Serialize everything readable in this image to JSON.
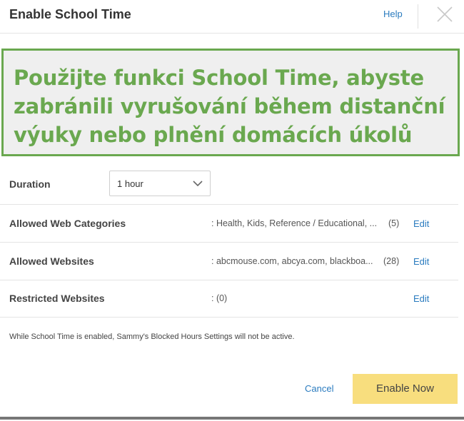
{
  "dialog": {
    "title": "Enable School Time",
    "help_label": "Help"
  },
  "banner": {
    "text": "Použijte funkci School Time, abyste zabránili vyrušování během distanční výuky nebo plnění domácích úkolů"
  },
  "duration": {
    "label": "Duration",
    "selected": "1 hour"
  },
  "rows": [
    {
      "label": "Allowed Web Categories",
      "value": ": Health, Kids, Reference / Educational, ...",
      "count": "(5)",
      "edit": "Edit"
    },
    {
      "label": "Allowed Websites",
      "value": ": abcmouse.com, abcya.com, blackboa...",
      "count": "(28)",
      "edit": "Edit"
    },
    {
      "label": "Restricted Websites",
      "value": ": (0)",
      "count": "",
      "edit": "Edit"
    }
  ],
  "note": "While School Time is enabled, Sammy's Blocked Hours Settings will not be active.",
  "actions": {
    "cancel_label": "Cancel",
    "enable_label": "Enable Now"
  },
  "colors": {
    "banner_green": "#6aa84f",
    "link_blue": "#2a7bbf",
    "enable_button": "#f8de7e"
  },
  "icons": {
    "close": "close-icon",
    "dropdown": "chevron-down-icon"
  }
}
